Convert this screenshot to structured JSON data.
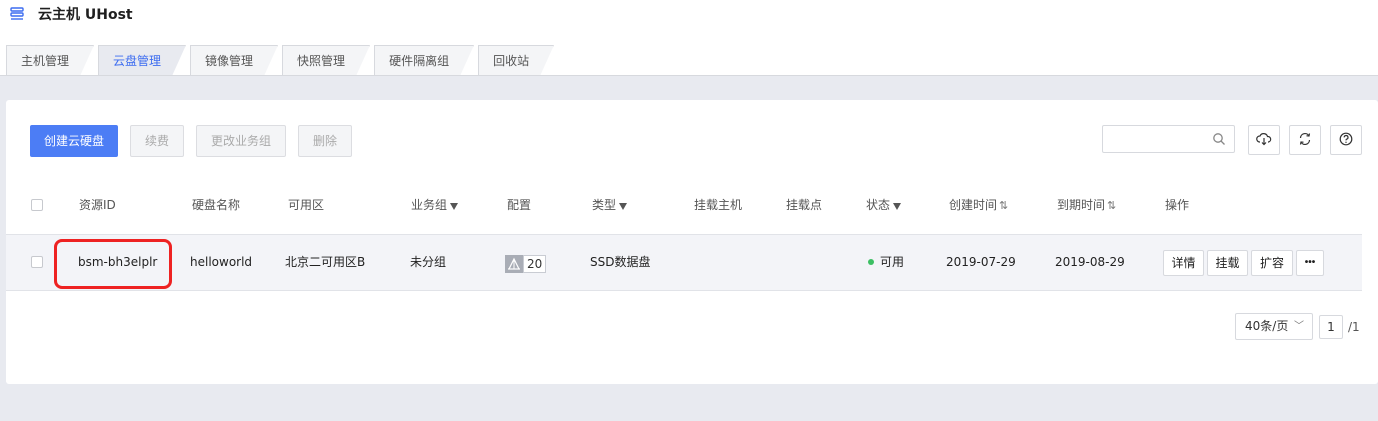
{
  "app": {
    "title": "云主机 UHost",
    "menu_icon": "menu-icon"
  },
  "tabs": [
    {
      "label": "主机管理",
      "active": false
    },
    {
      "label": "云盘管理",
      "active": true
    },
    {
      "label": "镜像管理",
      "active": false
    },
    {
      "label": "快照管理",
      "active": false
    },
    {
      "label": "硬件隔离组",
      "active": false
    },
    {
      "label": "回收站",
      "active": false
    }
  ],
  "toolbar": {
    "create_label": "创建云硬盘",
    "renew_label": "续费",
    "change_group_label": "更改业务组",
    "delete_label": "删除",
    "search_value": "",
    "icons": [
      "download-icon",
      "refresh-icon",
      "help-icon"
    ]
  },
  "table": {
    "columns": {
      "resource_id": "资源ID",
      "disk_name": "硬盘名称",
      "zone": "可用区",
      "group": "业务组",
      "config": "配置",
      "type": "类型",
      "host": "挂载主机",
      "mount_point": "挂载点",
      "status": "状态",
      "created": "创建时间",
      "expires": "到期时间",
      "actions": "操作"
    },
    "rows": [
      {
        "resource_id": "bsm-bh3elplr",
        "disk_name": "helloworld",
        "zone": "北京二可用区B",
        "group": "未分组",
        "config_size": "20",
        "type": "SSD数据盘",
        "host": "",
        "mount_point": "",
        "status": "可用",
        "status_color": "#3cbf63",
        "created": "2019-07-29",
        "expires": "2019-08-29",
        "actions": {
          "detail": "详情",
          "mount": "挂载",
          "expand": "扩容",
          "more": "•••"
        }
      }
    ]
  },
  "pagination": {
    "page_size": "40条/页",
    "current_page": "1",
    "total_pages": "/1"
  },
  "colors": {
    "primary": "#4c7df5",
    "highlight_box": "#ee2222"
  }
}
